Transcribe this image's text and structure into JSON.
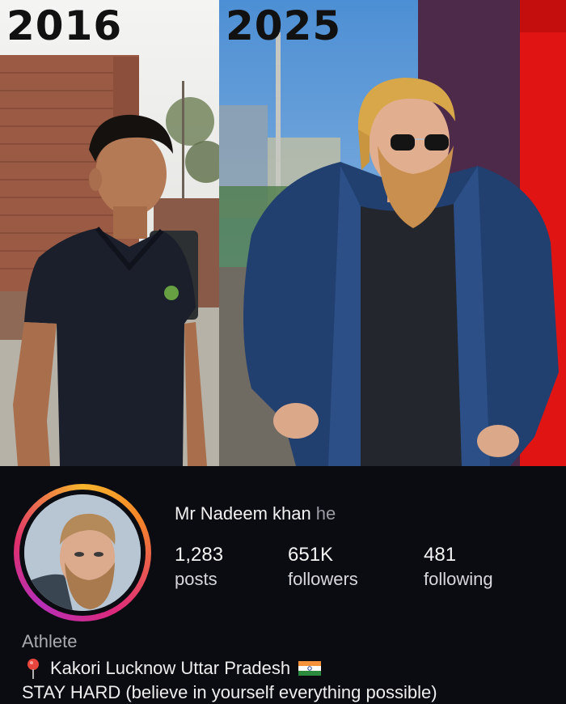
{
  "comparison": {
    "left_year": "2016",
    "right_year": "2025"
  },
  "profile": {
    "username": "Mr Nadeem khan",
    "pronoun": "he",
    "stats": {
      "posts_value": "1,283",
      "posts_label": "posts",
      "followers_value": "651K",
      "followers_label": "followers",
      "following_value": "481",
      "following_label": "following"
    },
    "category": "Athlete",
    "location": "Kakori Lucknow Uttar Pradesh",
    "bio": "STAY HARD (believe in yourself everything possible)",
    "icons": {
      "location": "pin-icon",
      "flag": "india-flag-icon"
    },
    "colors": {
      "background": "#0b0c12",
      "muted_text": "#9a9ca3",
      "ring_gradient": [
        "#f7b52c",
        "#f58529",
        "#dd2a7b",
        "#b62fb7"
      ]
    }
  }
}
